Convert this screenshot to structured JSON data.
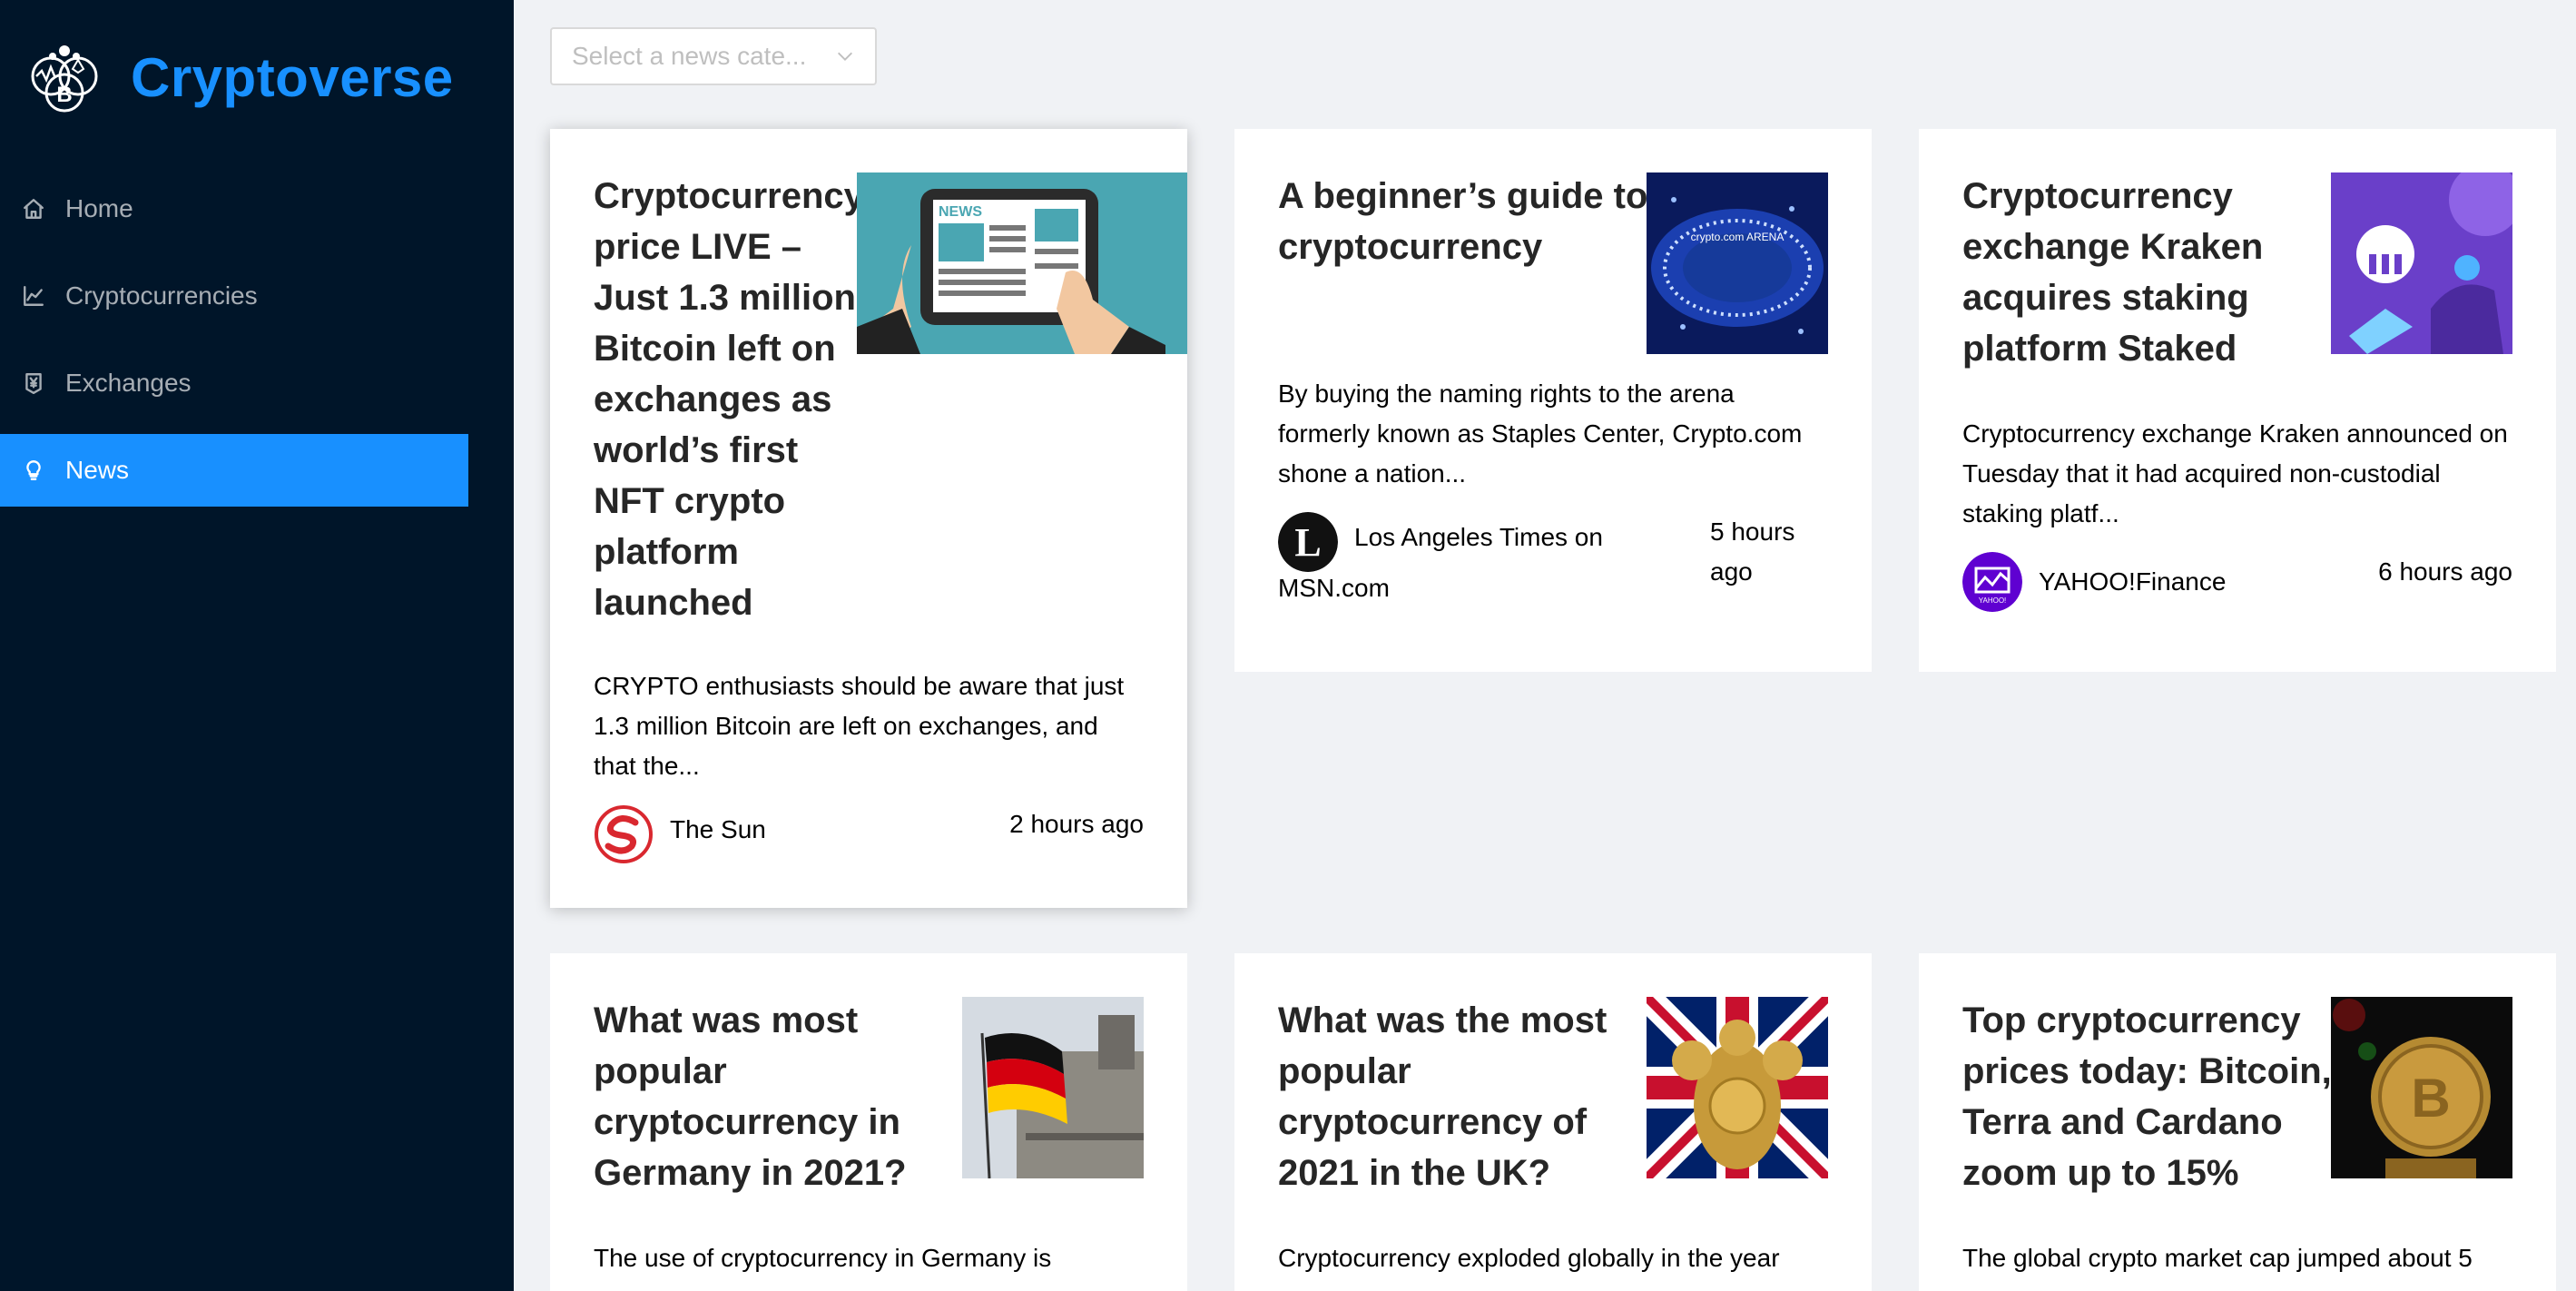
{
  "app": {
    "title": "Cryptoverse"
  },
  "sidebar": {
    "items": [
      {
        "label": "Home",
        "icon": "home-icon",
        "active": false
      },
      {
        "label": "Cryptocurrencies",
        "icon": "line-chart-icon",
        "active": false
      },
      {
        "label": "Exchanges",
        "icon": "money-collect-icon",
        "active": false
      },
      {
        "label": "News",
        "icon": "bulb-icon",
        "active": true
      }
    ]
  },
  "filter": {
    "placeholder": "Select a news cate..."
  },
  "colors": {
    "sidebar_bg": "#001529",
    "accent": "#1890ff",
    "page_bg": "#f0f2f5"
  },
  "news": [
    {
      "title": "Cryptocurrency price LIVE – Just 1.3 million Bitcoin left on exchanges as world’s first NFT crypto platform launched",
      "description": "CRYPTO enthusiasts should be aware that just 1.3 million Bitcoin are left on exchanges, and that the...",
      "provider": "The Sun",
      "time": "2 hours ago"
    },
    {
      "title": "A beginner’s guide to cryptocurrency",
      "description": "By buying the naming rights to the arena formerly known as Staples Center, Crypto.com shone a nation...",
      "provider": "Los Angeles Times on MSN.com",
      "time": "5 hours ago"
    },
    {
      "title": "Cryptocurrency exchange Kraken acquires staking platform Staked",
      "description": "Cryptocurrency exchange Kraken announced on Tuesday that it had acquired non-custodial staking platf...",
      "provider": "YAHOO!Finance",
      "time": "6 hours ago"
    },
    {
      "title": "What was most popular cryptocurrency in Germany in 2021?",
      "description": "The use of cryptocurrency in Germany is"
    },
    {
      "title": "What was the most popular cryptocurrency of 2021 in the UK?",
      "description": "Cryptocurrency exploded globally in the year"
    },
    {
      "title": "Top cryptocurrency prices today: Bitcoin, Terra and Cardano zoom up to 15%",
      "description": "The global crypto market cap jumped about 5"
    }
  ],
  "image_labels": {
    "news_tablet": "NEWS",
    "arena": "crypto.com ARENA",
    "yahoo": "YAHOO!"
  }
}
